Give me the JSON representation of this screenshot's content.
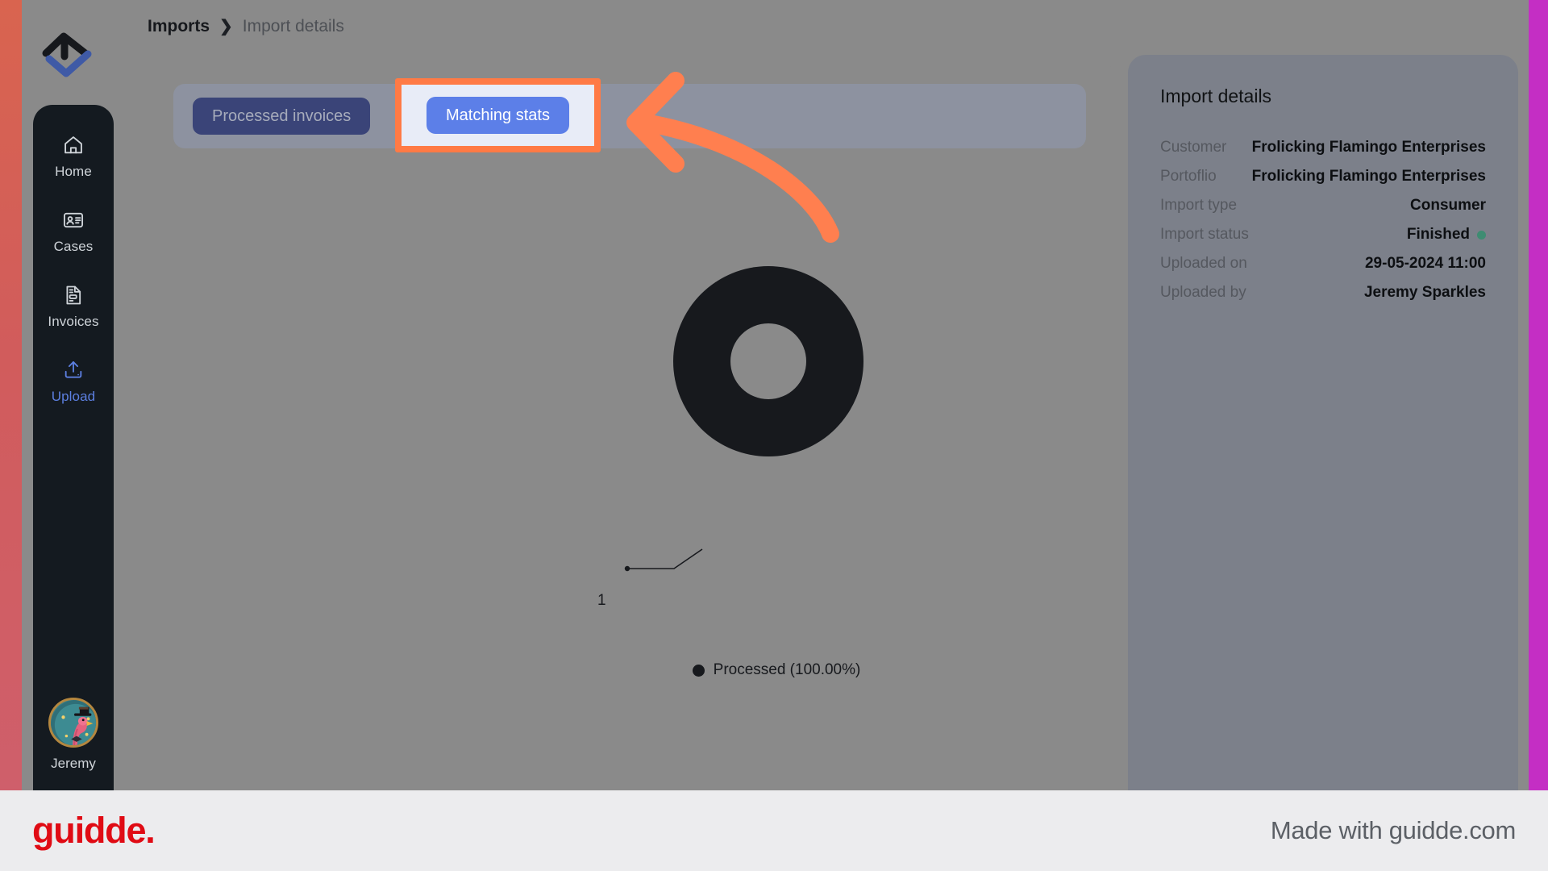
{
  "brand": {
    "logo_name": "company-logo",
    "accent_left": "#d15c5c",
    "accent_right": "#c42ec4"
  },
  "sidebar": {
    "items": [
      {
        "label": "Home",
        "icon": "home-icon",
        "active": false
      },
      {
        "label": "Cases",
        "icon": "id-card-icon",
        "active": false
      },
      {
        "label": "Invoices",
        "icon": "document-icon",
        "active": false
      },
      {
        "label": "Upload",
        "icon": "upload-icon",
        "active": true
      }
    ],
    "profile": {
      "name": "Jeremy",
      "avatar": "flamingo-avatar"
    }
  },
  "breadcrumb": {
    "root": "Imports",
    "separator": "❯",
    "leaf": "Import details"
  },
  "tabs": [
    {
      "label": "Processed invoices",
      "active": false
    },
    {
      "label": "Matching stats",
      "active": true
    }
  ],
  "highlight": {
    "target": "Matching stats",
    "border_color": "#ff7a45",
    "fill_color": "#e8ecf7",
    "arrow_color": "#ff7f4f"
  },
  "chart_data": {
    "type": "pie",
    "title": "",
    "donut": true,
    "labels": [
      "Processed"
    ],
    "values": [
      1
    ],
    "percentages": [
      "100.00%"
    ],
    "point_labels": [
      "1"
    ],
    "colors": [
      "#17191d"
    ],
    "legend": [
      "Processed (100.00%)"
    ],
    "legend_position": "bottom",
    "total": 1
  },
  "details": {
    "title": "Import details",
    "rows": [
      {
        "label": "Customer",
        "value": "Frolicking Flamingo Enterprises"
      },
      {
        "label": "Portoflio",
        "value": "Frolicking Flamingo Enterprises"
      },
      {
        "label": "Import type",
        "value": "Consumer"
      },
      {
        "label": "Import status",
        "value": "Finished",
        "status_color": "#3e8c72"
      },
      {
        "label": "Uploaded on",
        "value": "29-05-2024 11:00"
      },
      {
        "label": "Uploaded by",
        "value": "Jeremy Sparkles"
      }
    ]
  },
  "footer": {
    "brand": "guidde.",
    "made_with": "Made with guidde.com"
  }
}
